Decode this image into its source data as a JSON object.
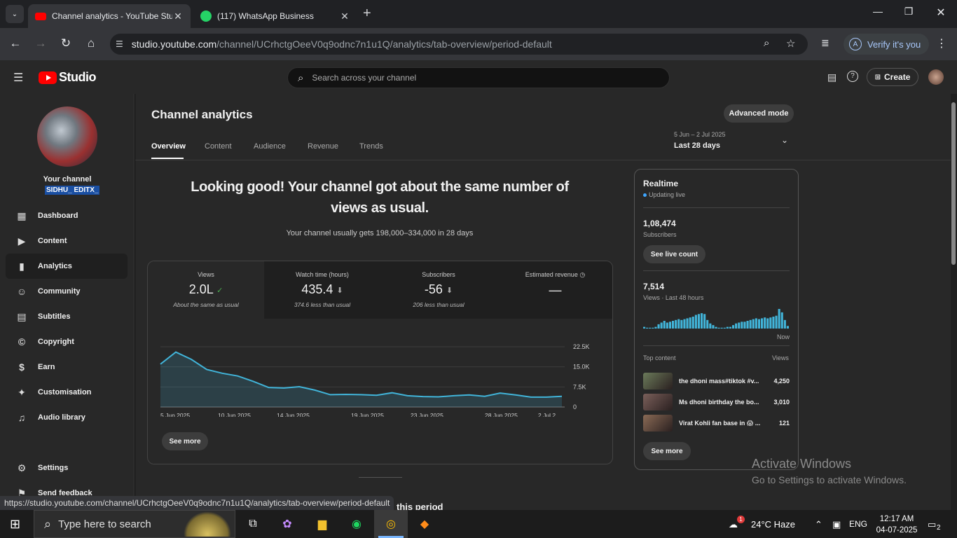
{
  "browser": {
    "tabs": [
      {
        "title": "Channel analytics - YouTube Studio",
        "active": true
      },
      {
        "title": "(117) WhatsApp Business",
        "active": false
      }
    ],
    "url_host": "studio.youtube.com",
    "url_path": "/channel/UCrhctgOeeV0q9odnc7n1u1Q/analytics/tab-overview/period-default",
    "verify_label": "Verify it's you",
    "verify_avatar": "A",
    "status_url": "https://studio.youtube.com/channel/UCrhctgOeeV0q9odnc7n1u1Q/analytics/tab-overview/period-default"
  },
  "header": {
    "logo_text": "Studio",
    "search_placeholder": "Search across your channel",
    "create_label": "Create"
  },
  "sidebar": {
    "your_channel": "Your channel",
    "channel_name": "SIDHU_ EDITX_",
    "items": [
      {
        "label": "Dashboard",
        "icon": "dashboard-icon",
        "glyph": "▦"
      },
      {
        "label": "Content",
        "icon": "content-icon",
        "glyph": "▶"
      },
      {
        "label": "Analytics",
        "icon": "analytics-icon",
        "glyph": "▮",
        "selected": true
      },
      {
        "label": "Community",
        "icon": "community-icon",
        "glyph": "☺"
      },
      {
        "label": "Subtitles",
        "icon": "subtitles-icon",
        "glyph": "▤"
      },
      {
        "label": "Copyright",
        "icon": "copyright-icon",
        "glyph": "©"
      },
      {
        "label": "Earn",
        "icon": "earn-icon",
        "glyph": "$"
      },
      {
        "label": "Customisation",
        "icon": "customisation-icon",
        "glyph": "✦"
      },
      {
        "label": "Audio library",
        "icon": "audio-library-icon",
        "glyph": "♫"
      }
    ],
    "settings": "Settings",
    "feedback": "Send feedback"
  },
  "main": {
    "title": "Channel analytics",
    "advanced_mode": "Advanced mode",
    "tabs": [
      "Overview",
      "Content",
      "Audience",
      "Revenue",
      "Trends"
    ],
    "period_range": "5 Jun – 2 Jul 2025",
    "period_label": "Last 28 days",
    "headline": "Looking good! Your channel got about the same number of views as usual.",
    "subline": "Your channel usually gets 198,000–334,000 in 28 days",
    "metrics": [
      {
        "label": "Views",
        "value": "2.0L",
        "icon": "check-circle-icon",
        "note": "About the same as usual"
      },
      {
        "label": "Watch time (hours)",
        "value": "435.4",
        "icon": "down-arrow-circle-icon",
        "note": "374.6 less than usual"
      },
      {
        "label": "Subscribers",
        "value": "-56",
        "icon": "down-arrow-circle-icon",
        "note": "206 less than usual"
      },
      {
        "label": "Estimated revenue",
        "value": "—",
        "icon": "clock-icon",
        "note": ""
      }
    ],
    "see_more": "See more",
    "bottom_heading_partial": "this period"
  },
  "chart_data": {
    "type": "area",
    "x_ticks": [
      "5 Jun 2025",
      "10 Jun 2025",
      "14 Jun 2025",
      "19 Jun 2025",
      "23 Jun 2025",
      "28 Jun 2025",
      "2 Jul 2..."
    ],
    "y_ticks": [
      "22.5K",
      "15.0K",
      "7.5K",
      "0"
    ],
    "ylim": [
      0,
      22500
    ],
    "values": [
      16000,
      20500,
      17800,
      14000,
      12600,
      11600,
      9600,
      7300,
      7100,
      7600,
      6300,
      4600,
      4700,
      4600,
      4400,
      5300,
      4200,
      3900,
      3800,
      4200,
      4500,
      4000,
      5200,
      4500,
      3700,
      3700,
      4000
    ],
    "color": "#41b4d9"
  },
  "realtime": {
    "title": "Realtime",
    "live": "Updating live",
    "subscribers_value": "1,08,474",
    "subscribers_label": "Subscribers",
    "see_live_count": "See live count",
    "views_value": "7,514",
    "views_label": "Views · Last 48 hours",
    "now_label": "Now",
    "bars": [
      2,
      1,
      1,
      1,
      2,
      5,
      7,
      9,
      7,
      8,
      9,
      10,
      11,
      10,
      11,
      12,
      13,
      14,
      16,
      17,
      18,
      17,
      10,
      6,
      4,
      2,
      1,
      1,
      1,
      2,
      2,
      4,
      6,
      7,
      8,
      8,
      9,
      10,
      11,
      12,
      11,
      12,
      13,
      12,
      13,
      14,
      15,
      23,
      19,
      10,
      3
    ],
    "top_content_label": "Top content",
    "views_col": "Views",
    "top_content": [
      {
        "title": "the dhoni mass#tiktok #v...",
        "views": "4,250",
        "color": "#6b7a5a"
      },
      {
        "title": "Ms dhoni birthday the bo...",
        "views": "3,010",
        "color": "#7a5f5a"
      },
      {
        "title": "Virat Kohli fan base in 😱 ...",
        "views": "121",
        "color": "#8a6a55"
      }
    ],
    "see_more": "See more"
  },
  "watermark": {
    "line1": "Activate Windows",
    "line2": "Go to Settings to activate Windows."
  },
  "taskbar": {
    "search_placeholder": "Type here to search",
    "weather": "24°C  Haze",
    "lang": "ENG",
    "time": "12:17 AM",
    "date": "04-07-2025",
    "notifications": "2",
    "weather_badge": "1"
  },
  "colors": {
    "accent": "#ff0000",
    "chart": "#41b4d9",
    "selection": "#1a4fa3"
  }
}
